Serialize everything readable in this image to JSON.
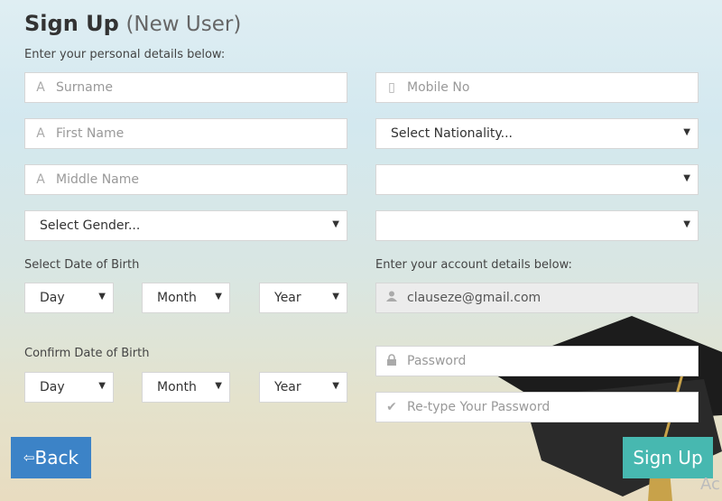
{
  "header": {
    "title": "Sign Up",
    "subtitle": "(New User)"
  },
  "labels": {
    "personal": "Enter your personal details below:",
    "dob": "Select Date of Birth",
    "confirm_dob": "Confirm Date of Birth",
    "account": "Enter your account details below:"
  },
  "fields": {
    "surname": "Surname",
    "first_name": "First Name",
    "middle_name": "Middle Name",
    "gender": "Select Gender...",
    "mobile": "Mobile No",
    "nationality": "Select Nationality...",
    "blank1": "",
    "blank2": "",
    "email": "clauseze@gmail.com",
    "password": "Password",
    "retype": "Re-type Your Password"
  },
  "dob": {
    "day": "Day",
    "month": "Month",
    "year": "Year"
  },
  "confirm": {
    "day": "Day",
    "month": "Month",
    "year": "Year"
  },
  "buttons": {
    "back": "Back",
    "sign_up": "Sign Up"
  },
  "watermark": "Ac"
}
